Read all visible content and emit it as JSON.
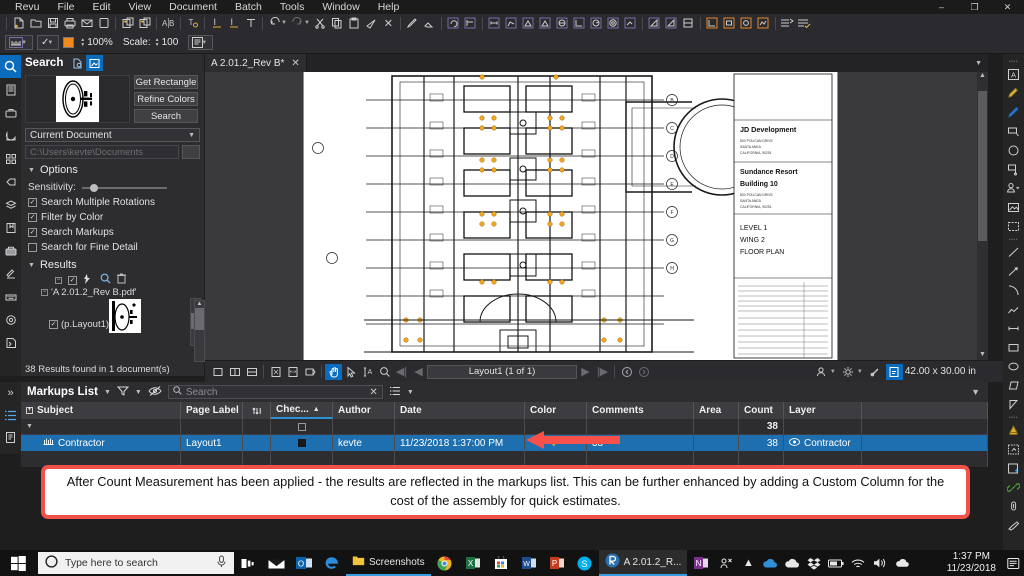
{
  "app": {
    "menu": [
      "Revu",
      "File",
      "Edit",
      "View",
      "Document",
      "Batch",
      "Tools",
      "Window",
      "Help"
    ],
    "window_controls": [
      "minimize",
      "restore",
      "close"
    ]
  },
  "toolbar": {
    "zoom_value": "100%",
    "scale_label": "Scale:",
    "scale_value": "100"
  },
  "search_panel": {
    "title": "Search",
    "buttons": {
      "get_rectangle": "Get Rectangle",
      "refine_colors": "Refine Colors",
      "search": "Search"
    },
    "scope_value": "Current Document",
    "path_placeholder": "C:\\Users\\kevte\\Documents",
    "options_label": "Options",
    "sensitivity_label": "Sensitivity:",
    "checkboxes": [
      {
        "label": "Search Multiple Rotations",
        "checked": true
      },
      {
        "label": "Filter by Color",
        "checked": true
      },
      {
        "label": "Search Markups",
        "checked": true
      },
      {
        "label": "Search for Fine Detail",
        "checked": false
      }
    ],
    "results_label": "Results",
    "tree": {
      "document": "'A 2.01.2_Rev B.pdf'",
      "page": "(p.Layout1)"
    },
    "results_count": "38 Results found in 1 document(s)"
  },
  "document": {
    "tab_label": "A 2.01.2_Rev B*",
    "page_field": "Layout1 (1 of 1)",
    "dimensions": "42.00 x 30.00 in",
    "titleblock": {
      "company": "JD Development",
      "company_address": [
        "800 POLICAN DRIVE",
        "SANTA ANEA",
        "CALIFORNIA, 90251"
      ],
      "project": [
        "Sundance Resort",
        "Building 10"
      ],
      "project_address": [
        "800 POLICAN DRIVE",
        "SANTA ANEA",
        "CALIFORNIA, 90251"
      ],
      "sheet": [
        "LEVEL 1",
        "WING 2",
        "FLOOR PLAN"
      ]
    }
  },
  "markups_list": {
    "title": "Markups List",
    "search_placeholder": "Search",
    "columns": [
      "Subject",
      "Page Label",
      "",
      "Chec...",
      "Author",
      "Date",
      "Color",
      "Comments",
      "Area",
      "Count",
      "Layer",
      ""
    ],
    "summary_row": {
      "count": "38"
    },
    "rows": [
      {
        "subject": "Contractor",
        "page_label": "Layout1",
        "checked": "filled",
        "author": "kevte",
        "date": "11/23/2018 1:37:00 PM",
        "color": "check",
        "comments": "38",
        "area": "",
        "count": "38",
        "layer": "Contractor"
      }
    ]
  },
  "caption": {
    "text": "After Count Measurement has been applied - the results are reflected in the markups list. This can be further enhanced by adding a Custom Column for the cost of the assembly for quick estimates."
  },
  "taskbar": {
    "search_placeholder": "Type here to search",
    "apps": [
      {
        "name": "Screenshots",
        "label": "Screenshots"
      },
      {
        "name": "Bluebeam Revu",
        "label": "A 2.01.2_R..."
      }
    ],
    "time": "1:37 PM",
    "date": "11/23/2018"
  },
  "colors": {
    "accent_blue": "#0a6cbd",
    "selection_blue": "#1e6fb0",
    "markup_orange": "#f08a1a",
    "callout_red": "#f2514a"
  }
}
